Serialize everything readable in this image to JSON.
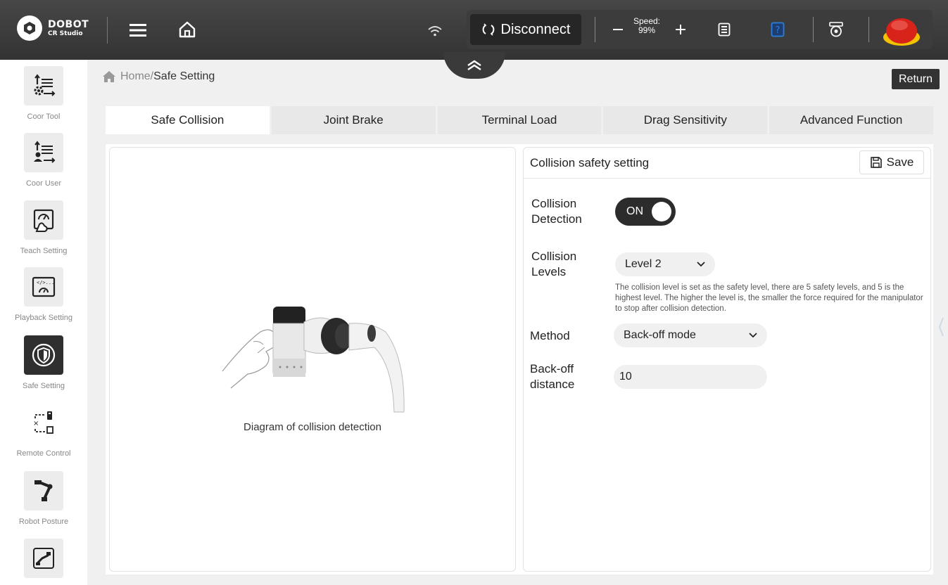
{
  "app": {
    "brand": "DOBOT",
    "product": "CR Studio"
  },
  "topbar": {
    "disconnect_label": "Disconnect",
    "speed_title": "Speed:",
    "speed_value": "99%",
    "icons": [
      "menu-icon",
      "home-icon",
      "wifi-icon",
      "disconnect-icon",
      "minus-icon",
      "plus-icon",
      "log-icon",
      "help-icon",
      "camera-icon",
      "emergency-stop-icon"
    ]
  },
  "sidebar": {
    "items": [
      {
        "label": "Coor Tool",
        "icon": "coor-tool-icon"
      },
      {
        "label": "Coor User",
        "icon": "coor-user-icon"
      },
      {
        "label": "Teach Setting",
        "icon": "teach-setting-icon"
      },
      {
        "label": "Playback Setting",
        "icon": "playback-setting-icon"
      },
      {
        "label": "Safe Setting",
        "icon": "shield-icon"
      },
      {
        "label": "Remote Control",
        "icon": "remote-control-icon"
      },
      {
        "label": "Robot Posture",
        "icon": "robot-arm-icon"
      },
      {
        "label": "",
        "icon": "robot-base-icon"
      }
    ]
  },
  "breadcrumb": {
    "home": "Home/",
    "current": "Safe Setting"
  },
  "return_label": "Return",
  "tabs": [
    "Safe Collision",
    "Joint Brake",
    "Terminal Load",
    "Drag Sensitivity",
    "Advanced Function"
  ],
  "diagram": {
    "caption": "Diagram of collision detection"
  },
  "settings": {
    "title": "Collision safety setting",
    "save_label": "Save",
    "collision_detection": {
      "label_line1": "Collision",
      "label_line2": "Detection",
      "value": "ON"
    },
    "collision_levels": {
      "label_line1": "Collision",
      "label_line2": "Levels",
      "value": "Level 2",
      "help": "The collision level is set as the safety level, there are 5 safety levels, and 5 is the highest level. The higher the level is, the smaller the force required for the manipulator to stop after collision detection."
    },
    "method": {
      "label": "Method",
      "value": "Back-off mode"
    },
    "backoff_distance": {
      "label_line1": "Back-off",
      "label_line2": "distance",
      "value": "10"
    }
  },
  "colors": {
    "topbar": "#3a3a3a",
    "estop": "#e02a22",
    "active_dark": "#2f2f2f",
    "help_icon_blue": "#2a7fe0"
  }
}
